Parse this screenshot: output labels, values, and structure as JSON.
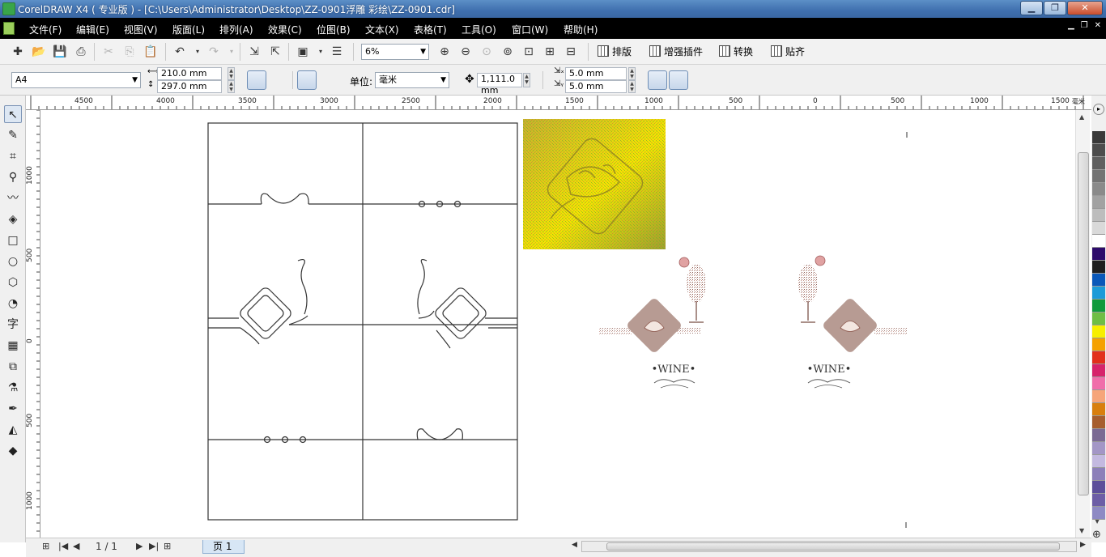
{
  "window": {
    "title": "CorelDRAW X4 ( 专业版 ) - [C:\\Users\\Administrator\\Desktop\\ZZ-0901浮雕 彩绘\\ZZ-0901.cdr]",
    "minimize": "▁",
    "maximize": "❐",
    "close": "✕"
  },
  "menu": [
    "文件(F)",
    "编辑(E)",
    "视图(V)",
    "版面(L)",
    "排列(A)",
    "效果(C)",
    "位图(B)",
    "文本(X)",
    "表格(T)",
    "工具(O)",
    "窗口(W)",
    "帮助(H)"
  ],
  "toolbar": {
    "zoom": "6%",
    "plugins": [
      "排版",
      "增强插件",
      "转换",
      "贴齐"
    ]
  },
  "property_bar": {
    "page_size": "A4",
    "width": "210.0 mm",
    "height": "297.0 mm",
    "units_label": "单位:",
    "units": "毫米",
    "nudge": "1,111.0 mm",
    "dup_x": "5.0 mm",
    "dup_y": "5.0 mm"
  },
  "ruler": {
    "h_labels": [
      "4500",
      "4000",
      "3500",
      "3000",
      "2500",
      "2000",
      "1500",
      "1000",
      "500",
      "0",
      "500",
      "1000",
      "1500"
    ],
    "h_unit": "毫米",
    "v_labels": [
      "1000",
      "500",
      "0",
      "500",
      "1000"
    ]
  },
  "canvas": {
    "wine_text_left": "•WINE•",
    "wine_text_right": "•WINE•"
  },
  "status": {
    "page_counter": "1 / 1",
    "page_tab": "页 1"
  },
  "palette": [
    "#3a3a3a",
    "#4d4d4d",
    "#606060",
    "#737373",
    "#8a8a8a",
    "#a2a2a2",
    "#bdbdbd",
    "#d9d9d9",
    "#ffffff",
    "#2d0b6b",
    "#1f1f1f",
    "#0a58b9",
    "#1c9bd8",
    "#0f9a3c",
    "#6fbe45",
    "#f7ef00",
    "#f5a100",
    "#e2301b",
    "#d6246b",
    "#f06eaa",
    "#f6a57a",
    "#d87f0e",
    "#a65e2e",
    "#7b6a93",
    "#a396c6",
    "#c3b9e0",
    "#8c7fb9",
    "#5d4f9a",
    "#6d5ea6",
    "#8e8ac4"
  ]
}
